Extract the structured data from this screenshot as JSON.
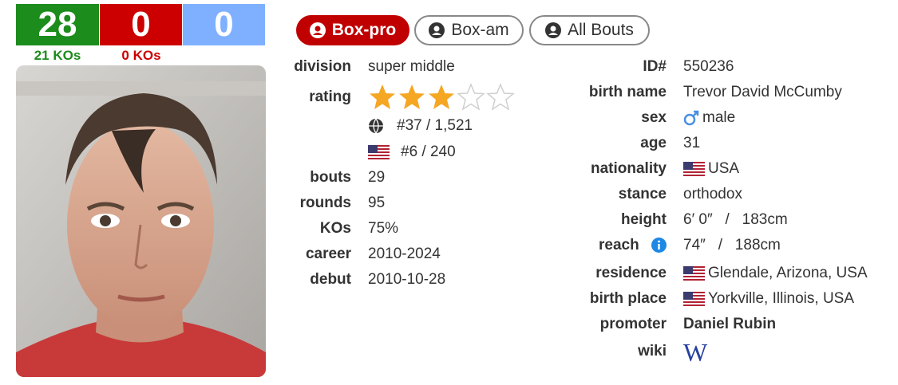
{
  "record": {
    "wins": "28",
    "losses": "0",
    "draws": "0",
    "win_kos": "21 KOs",
    "loss_kos": "0 KOs"
  },
  "tabs": [
    {
      "label": "Box-pro",
      "active": true
    },
    {
      "label": "Box-am",
      "active": false
    },
    {
      "label": "All Bouts",
      "active": false
    }
  ],
  "left_info": {
    "division": {
      "label": "division",
      "value": "super middle"
    },
    "rating": {
      "label": "rating",
      "stars": 3,
      "max_stars": 5,
      "world_rank": "#37 / 1,521",
      "country_rank": "#6 / 240"
    },
    "bouts": {
      "label": "bouts",
      "value": "29"
    },
    "rounds": {
      "label": "rounds",
      "value": "95"
    },
    "kos": {
      "label": "KOs",
      "value": "75%"
    },
    "career": {
      "label": "career",
      "value": "2010-2024"
    },
    "debut": {
      "label": "debut",
      "value": "2010-10-28"
    }
  },
  "right_info": {
    "id": {
      "label": "ID#",
      "value": "550236"
    },
    "birth_name": {
      "label": "birth name",
      "value": "Trevor David McCumby"
    },
    "sex": {
      "label": "sex",
      "value": "male",
      "icon": "male-icon"
    },
    "age": {
      "label": "age",
      "value": "31"
    },
    "nationality": {
      "label": "nationality",
      "value": "USA",
      "icon": "us-flag-icon"
    },
    "stance": {
      "label": "stance",
      "value": "orthodox"
    },
    "height": {
      "label": "height",
      "value": "6′ 0″   /   183cm"
    },
    "reach": {
      "label": "reach",
      "value": "74″   /   188cm",
      "icon": "info-icon"
    },
    "residence": {
      "label": "residence",
      "value": "Glendale, Arizona, USA",
      "icon": "us-flag-icon"
    },
    "birth_place": {
      "label": "birth place",
      "value": "Yorkville, Illinois, USA",
      "icon": "us-flag-icon"
    },
    "promoter": {
      "label": "promoter",
      "value": "Daniel Rubin"
    },
    "wiki": {
      "label": "wiki",
      "icon": "wikipedia-icon",
      "glyph": "W"
    }
  },
  "colors": {
    "win": "#1c8c1c",
    "loss": "#cc0000",
    "draw": "#7fb0ff",
    "star": "#f5a623",
    "accent": "#c00000"
  }
}
